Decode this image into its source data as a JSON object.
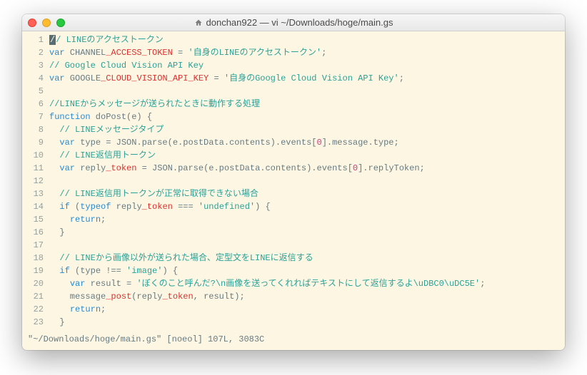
{
  "window": {
    "title": "donchan922 — vi ~/Downloads/hoge/main.gs"
  },
  "status_line": "\"~/Downloads/hoge/main.gs\" [noeol] 107L, 3083C",
  "lines": [
    {
      "n": "1",
      "tokens": [
        {
          "t": "cursor",
          "v": "/"
        },
        {
          "t": "comment",
          "v": "/ LINEのアクセストークン"
        }
      ]
    },
    {
      "n": "2",
      "tokens": [
        {
          "t": "keyword",
          "v": "var"
        },
        {
          "t": "ident",
          "v": " CHANNEL"
        },
        {
          "t": "varred",
          "v": "_ACCESS_TOKEN"
        },
        {
          "t": "op",
          "v": " = "
        },
        {
          "t": "string",
          "v": "'自身のLINEのアクセストークン'"
        },
        {
          "t": "op",
          "v": ";"
        }
      ]
    },
    {
      "n": "3",
      "tokens": [
        {
          "t": "comment",
          "v": "// Google Cloud Vision API Key"
        }
      ]
    },
    {
      "n": "4",
      "tokens": [
        {
          "t": "keyword",
          "v": "var"
        },
        {
          "t": "ident",
          "v": " GOOGLE"
        },
        {
          "t": "varred",
          "v": "_CLOUD_VISION_API_KEY"
        },
        {
          "t": "op",
          "v": " = "
        },
        {
          "t": "string",
          "v": "'自身のGoogle Cloud Vision API Key'"
        },
        {
          "t": "op",
          "v": ";"
        }
      ]
    },
    {
      "n": "5",
      "tokens": []
    },
    {
      "n": "6",
      "tokens": [
        {
          "t": "comment",
          "v": "//LINEからメッセージが送られたときに動作する処理"
        }
      ]
    },
    {
      "n": "7",
      "tokens": [
        {
          "t": "keyword",
          "v": "function"
        },
        {
          "t": "ident",
          "v": " doPost(e) {"
        }
      ]
    },
    {
      "n": "8",
      "tokens": [
        {
          "t": "ident",
          "v": "  "
        },
        {
          "t": "comment",
          "v": "// LINEメッセージタイプ"
        }
      ]
    },
    {
      "n": "9",
      "tokens": [
        {
          "t": "ident",
          "v": "  "
        },
        {
          "t": "keyword",
          "v": "var"
        },
        {
          "t": "ident",
          "v": " type = JSON.parse(e.postData.contents).events["
        },
        {
          "t": "number",
          "v": "0"
        },
        {
          "t": "ident",
          "v": "].message.type;"
        }
      ]
    },
    {
      "n": "10",
      "tokens": [
        {
          "t": "ident",
          "v": "  "
        },
        {
          "t": "comment",
          "v": "// LINE返信用トークン"
        }
      ]
    },
    {
      "n": "11",
      "tokens": [
        {
          "t": "ident",
          "v": "  "
        },
        {
          "t": "keyword",
          "v": "var"
        },
        {
          "t": "ident",
          "v": " reply"
        },
        {
          "t": "varred",
          "v": "_token"
        },
        {
          "t": "ident",
          "v": " = JSON.parse(e.postData.contents).events["
        },
        {
          "t": "number",
          "v": "0"
        },
        {
          "t": "ident",
          "v": "].replyToken;"
        }
      ]
    },
    {
      "n": "12",
      "tokens": []
    },
    {
      "n": "13",
      "tokens": [
        {
          "t": "ident",
          "v": "  "
        },
        {
          "t": "comment",
          "v": "// LINE返信用トークンが正常に取得できない場合"
        }
      ]
    },
    {
      "n": "14",
      "tokens": [
        {
          "t": "ident",
          "v": "  "
        },
        {
          "t": "keyword",
          "v": "if"
        },
        {
          "t": "ident",
          "v": " ("
        },
        {
          "t": "keyword",
          "v": "typeof"
        },
        {
          "t": "ident",
          "v": " reply"
        },
        {
          "t": "varred",
          "v": "_token"
        },
        {
          "t": "ident",
          "v": " === "
        },
        {
          "t": "string",
          "v": "'undefined'"
        },
        {
          "t": "ident",
          "v": ") {"
        }
      ]
    },
    {
      "n": "15",
      "tokens": [
        {
          "t": "ident",
          "v": "    "
        },
        {
          "t": "keyword",
          "v": "return"
        },
        {
          "t": "ident",
          "v": ";"
        }
      ]
    },
    {
      "n": "16",
      "tokens": [
        {
          "t": "ident",
          "v": "  }"
        }
      ]
    },
    {
      "n": "17",
      "tokens": []
    },
    {
      "n": "18",
      "tokens": [
        {
          "t": "ident",
          "v": "  "
        },
        {
          "t": "comment",
          "v": "// LINEから画像以外が送られた場合、定型文をLINEに返信する"
        }
      ]
    },
    {
      "n": "19",
      "tokens": [
        {
          "t": "ident",
          "v": "  "
        },
        {
          "t": "keyword",
          "v": "if"
        },
        {
          "t": "ident",
          "v": " (type !== "
        },
        {
          "t": "string",
          "v": "'image'"
        },
        {
          "t": "ident",
          "v": ") {"
        }
      ]
    },
    {
      "n": "20",
      "tokens": [
        {
          "t": "ident",
          "v": "    "
        },
        {
          "t": "keyword",
          "v": "var"
        },
        {
          "t": "ident",
          "v": " result = "
        },
        {
          "t": "string",
          "v": "'ぼくのこと呼んだ?\\n画像を送ってくれればテキストにして返信するよ\\uDBC0\\uDC5E'"
        },
        {
          "t": "ident",
          "v": ";"
        }
      ]
    },
    {
      "n": "21",
      "tokens": [
        {
          "t": "ident",
          "v": "    message"
        },
        {
          "t": "varred",
          "v": "_post"
        },
        {
          "t": "ident",
          "v": "(reply"
        },
        {
          "t": "varred",
          "v": "_token"
        },
        {
          "t": "ident",
          "v": ", result);"
        }
      ]
    },
    {
      "n": "22",
      "tokens": [
        {
          "t": "ident",
          "v": "    "
        },
        {
          "t": "keyword",
          "v": "return"
        },
        {
          "t": "ident",
          "v": ";"
        }
      ]
    },
    {
      "n": "23",
      "tokens": [
        {
          "t": "ident",
          "v": "  }"
        }
      ]
    }
  ]
}
